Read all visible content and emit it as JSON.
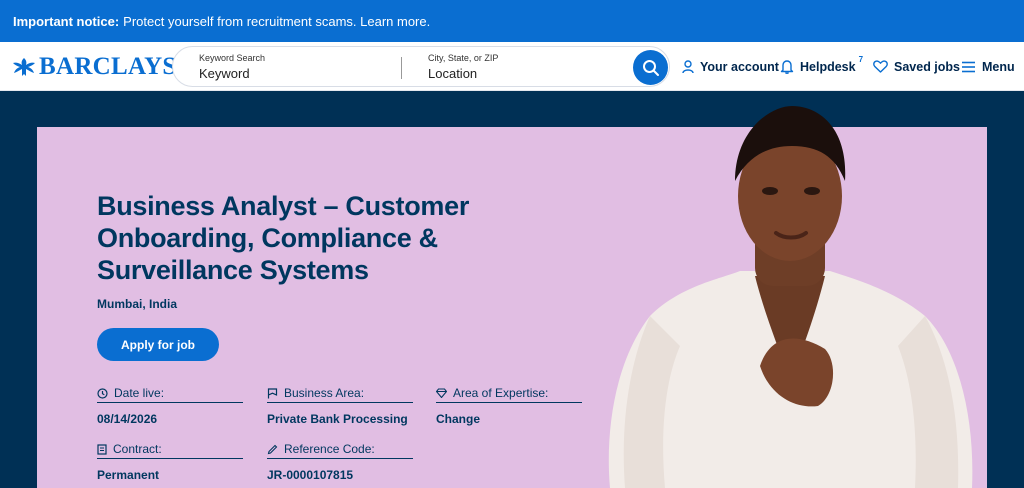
{
  "notice": {
    "bold": "Important notice:",
    "text": "Protect yourself from recruitment scams. Learn more."
  },
  "brand": {
    "name": "BARCLAYS",
    "color": "#0a6ed1"
  },
  "search": {
    "keyword_label": "Keyword Search",
    "keyword_value": "Keyword",
    "location_label": "City, State, or ZIP",
    "location_value": "Location",
    "button_icon": "search-icon"
  },
  "nav": {
    "account": "Your account",
    "helpdesk": "Helpdesk",
    "helpdesk_badge": "7",
    "saved": "Saved jobs",
    "menu": "Menu"
  },
  "job": {
    "title": "Business Analyst – Customer Onboarding, Compliance & Surveillance Systems",
    "location": "Mumbai, India",
    "apply_label": "Apply for job",
    "meta": [
      {
        "label": "Date live:",
        "value": "08/14/2026",
        "icon": "clock-icon"
      },
      {
        "label": "Business Area:",
        "value": "Private Bank Processing",
        "icon": "flag-icon"
      },
      {
        "label": "Area of Expertise:",
        "value": "Change",
        "icon": "diamond-icon"
      },
      {
        "label": "Contract:",
        "value": "Permanent",
        "icon": "document-icon"
      },
      {
        "label": "Reference Code:",
        "value": "JR-0000107815",
        "icon": "pencil-icon"
      }
    ]
  },
  "colors": {
    "hero_bg": "#003055",
    "card_bg": "#e1bee3",
    "text_dark": "#00375f",
    "primary": "#0a6ed1"
  }
}
